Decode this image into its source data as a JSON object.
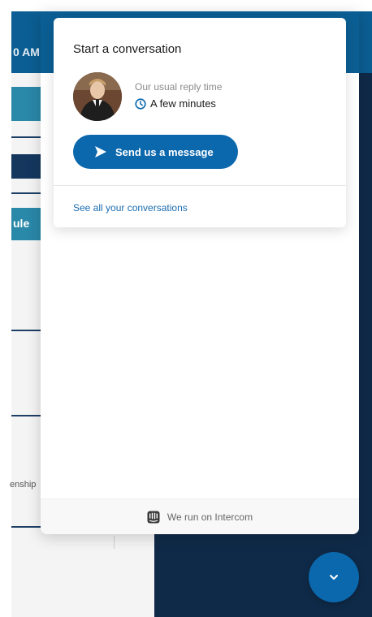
{
  "background": {
    "time_fragment": "0 AM",
    "schedule_fragment": "ule",
    "ship_fragment": "enship"
  },
  "widget": {
    "card": {
      "title": "Start a conversation",
      "reply_time_label": "Our usual reply time",
      "reply_time_value": "A few minutes",
      "send_button_label": "Send us a message",
      "see_all_link": "See all your conversations"
    },
    "footer": {
      "text": "We run on Intercom"
    },
    "icons": {
      "clock": "clock-icon",
      "send": "paper-plane-icon",
      "intercom": "intercom-logo-icon",
      "launcher": "chevron-down-icon"
    }
  },
  "colors": {
    "brand_blue": "#0b68ad",
    "header_blue": "#0b5e93",
    "link_blue": "#1a6cb0",
    "page_navy": "#0f2a48"
  }
}
